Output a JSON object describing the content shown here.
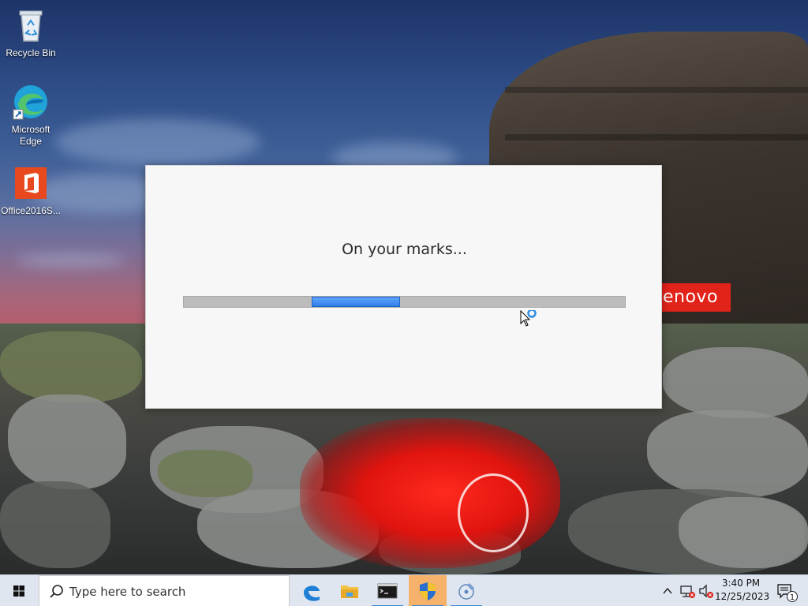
{
  "desktop": {
    "icons": [
      {
        "label": "Recycle Bin",
        "icon": "recycle-bin-icon"
      },
      {
        "label": "Microsoft Edge",
        "icon": "edge-icon"
      },
      {
        "label": "Office2016S...",
        "icon": "office-icon"
      }
    ],
    "brand_badge": "enovo"
  },
  "dialog": {
    "message": "On your marks...",
    "progress": {
      "start_fraction": 0.29,
      "fill_fraction": 0.2
    }
  },
  "taskbar": {
    "start_icon": "windows-logo-icon",
    "search_placeholder": "Type here to search",
    "apps": [
      {
        "name": "Microsoft Edge",
        "icon": "edge-icon",
        "active": false
      },
      {
        "name": "File Explorer",
        "icon": "folder-icon",
        "active": false
      },
      {
        "name": "Command Prompt",
        "icon": "terminal-icon",
        "active": false
      },
      {
        "name": "Setup",
        "icon": "shield-icon",
        "active": true
      },
      {
        "name": "Tool",
        "icon": "disc-tool-icon",
        "active": false
      }
    ],
    "clock": {
      "time": "3:40 PM",
      "date": "12/25/2023"
    },
    "notification_count": "1",
    "colors": {
      "accent": "#3a86d6",
      "active_app": "#f6b26b",
      "progress": "#2f7fe6",
      "brand": "#e2231a"
    }
  }
}
